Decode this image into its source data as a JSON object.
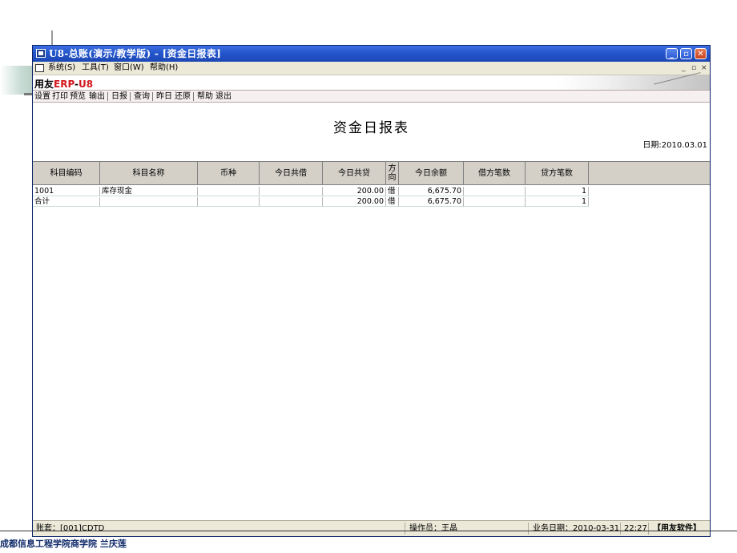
{
  "window": {
    "title": "U8-总账(演示/教学版) - [资金日报表]",
    "controls": {
      "minimize": "_",
      "maximize": "▫",
      "close": "✕"
    },
    "mdi_controls": {
      "minimize": "_",
      "restore": "▫",
      "close": "×"
    }
  },
  "menubar": [
    "系统(S)",
    "工具(T)",
    "窗口(W)",
    "帮助(H)"
  ],
  "brand": {
    "prefix": "用友",
    "erp": "ERP",
    "dash": "-",
    "u8": "U8"
  },
  "toolbar": [
    "设置",
    "打印",
    "预览",
    "输出",
    "日报",
    "查询",
    "昨日",
    "还原",
    "帮助",
    "退出"
  ],
  "report": {
    "title": "资金日报表",
    "date": "日期:2010.03.01",
    "columns": [
      "科目编码",
      "科目名称",
      "币种",
      "今日共借",
      "今日共贷",
      "方向",
      "今日余额",
      "借方笔数",
      "贷方笔数"
    ],
    "dir_col": {
      "top": "方",
      "bottom": "向"
    },
    "rows": [
      {
        "code": "1001",
        "name": "库存现金",
        "currency": "",
        "debit": "",
        "credit": "200.00",
        "direction": "借",
        "balance": "6,675.70",
        "debit_count": "",
        "credit_count": "1"
      },
      {
        "code": "合计",
        "name": "",
        "currency": "",
        "debit": "",
        "credit": "200.00",
        "direction": "借",
        "balance": "6,675.70",
        "debit_count": "",
        "credit_count": "1"
      }
    ]
  },
  "status": {
    "account": "账套：[001]CDTD",
    "operator": "操作员：王晶",
    "business_date": "业务日期：2010-03-31",
    "time": "22:27",
    "software": "【用友软件】"
  },
  "footer": "成都信息工程学院商学院 兰庆莲"
}
